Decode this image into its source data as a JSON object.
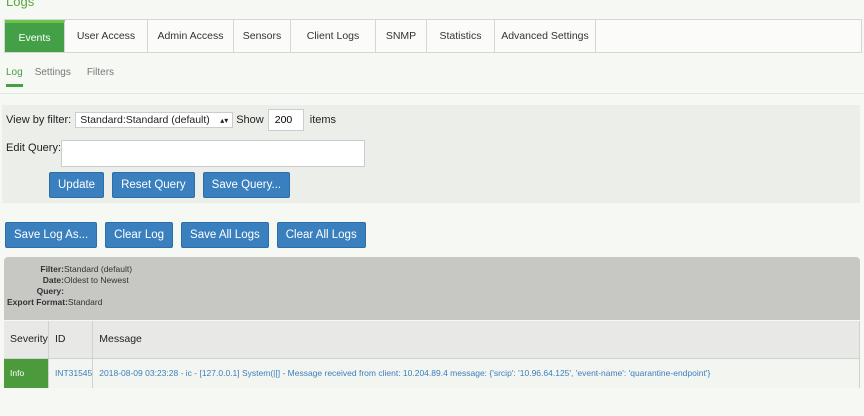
{
  "page": {
    "title": "Logs"
  },
  "main_tabs": [
    {
      "label": "Events",
      "active": true,
      "width": 60
    },
    {
      "label": "User Access",
      "active": false,
      "width": 83
    },
    {
      "label": "Admin Access",
      "active": false,
      "width": 86
    },
    {
      "label": "Sensors",
      "active": false,
      "width": 57
    },
    {
      "label": "Client Logs",
      "active": false,
      "width": 85
    },
    {
      "label": "SNMP",
      "active": false,
      "width": 51
    },
    {
      "label": "Statistics",
      "active": false,
      "width": 68
    },
    {
      "label": "Advanced Settings",
      "active": false,
      "width": 101
    }
  ],
  "sub_tabs": [
    {
      "label": "Log",
      "active": true
    },
    {
      "label": "Settings",
      "active": false
    },
    {
      "label": "Filters",
      "active": false
    }
  ],
  "filter": {
    "view_by_label": "View by filter:",
    "selected": "Standard:Standard (default)",
    "show_label": "Show",
    "show_count": "200",
    "items_label": "items",
    "edit_query_label": "Edit Query:",
    "query_value": "",
    "update": "Update",
    "reset": "Reset Query",
    "save_query": "Save Query..."
  },
  "actions": {
    "save_log_as": "Save Log As...",
    "clear_log": "Clear Log",
    "save_all": "Save All Logs",
    "clear_all": "Clear All Logs"
  },
  "info": {
    "filter_key": "Filter:",
    "filter_val": "Standard (default)",
    "date_key": "Date:",
    "date_val": "Oldest to Newest",
    "query_key": "Query:",
    "query_val": "",
    "export_key": "Export Format:",
    "export_val": "Standard"
  },
  "table": {
    "headers": [
      "Severity",
      "ID",
      "Message"
    ],
    "rows": [
      {
        "severity": "Info",
        "id": "INT31545",
        "message": "2018-08-09 03:23:28 - ic - [127.0.0.1] System(|[] - Message received from client: 10.204.89.4 message: {'srcip': '10.96.64.125', 'event-name': 'quarantine-endpoint'}"
      }
    ]
  },
  "colors": {
    "accent_green": "#43a047",
    "button_blue": "#3a7fbe"
  }
}
